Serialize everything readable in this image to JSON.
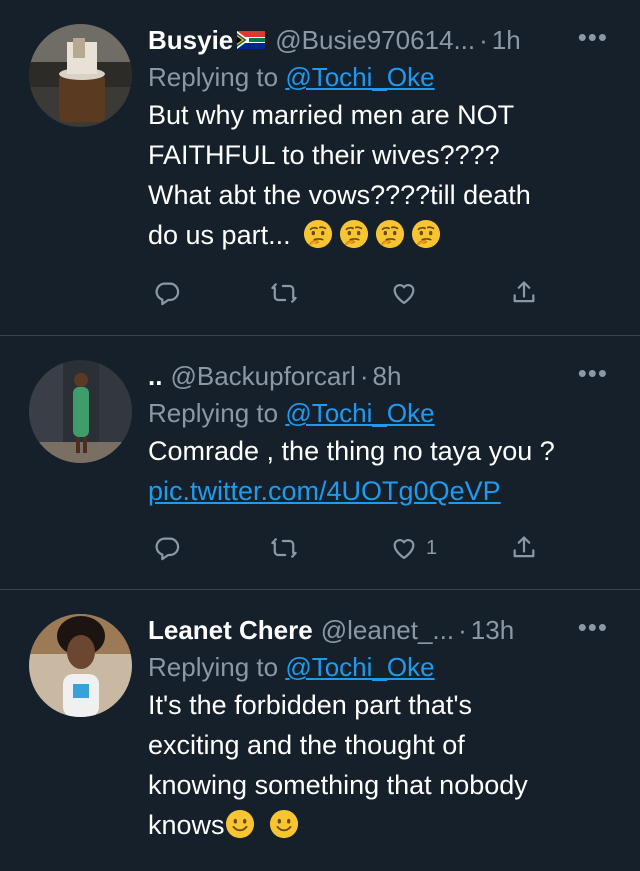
{
  "tweets": [
    {
      "name": "Busyie",
      "flag_icon": "south-africa-flag-icon",
      "handle": "@Busie970614...",
      "sep": "·",
      "time": "1h",
      "more": "•••",
      "reply_prefix": "Replying to",
      "reply_to": "@Tochi_Oke",
      "body_lines": [
        "But why married men are NOT",
        "FAITHFUL to their wives????",
        "What abt the vows????till death",
        "do us part..."
      ],
      "body_emojis": [
        "thinking-face-emoji",
        "thinking-face-emoji",
        "thinking-face-emoji",
        "thinking-face-emoji"
      ],
      "like_count": ""
    },
    {
      "name": "..",
      "handle": "@Backupforcarl",
      "sep": "·",
      "time": "8h",
      "more": "•••",
      "reply_prefix": "Replying to",
      "reply_to": "@Tochi_Oke",
      "body_lines": [
        "Comrade , the thing no taya you ?"
      ],
      "link": "pic.twitter.com/4UOTg0QeVP",
      "like_count": "1"
    },
    {
      "name": "Leanet Chere",
      "handle": "@leanet_...",
      "sep": "·",
      "time": "13h",
      "more": "•••",
      "reply_prefix": "Replying to",
      "reply_to": "@Tochi_Oke",
      "body_lines": [
        "It's the forbidden part that's",
        "exciting and the thought of",
        "knowing something that nobody",
        "knows"
      ],
      "body_emojis": [
        "slightly-smiling-face-emoji",
        "slightly-smiling-face-emoji"
      ],
      "like_count": ""
    }
  ],
  "colors": {
    "background": "#15202b",
    "secondary_text": "#8b98a5",
    "accent": "#1d9bf0",
    "divider": "#38444d"
  }
}
